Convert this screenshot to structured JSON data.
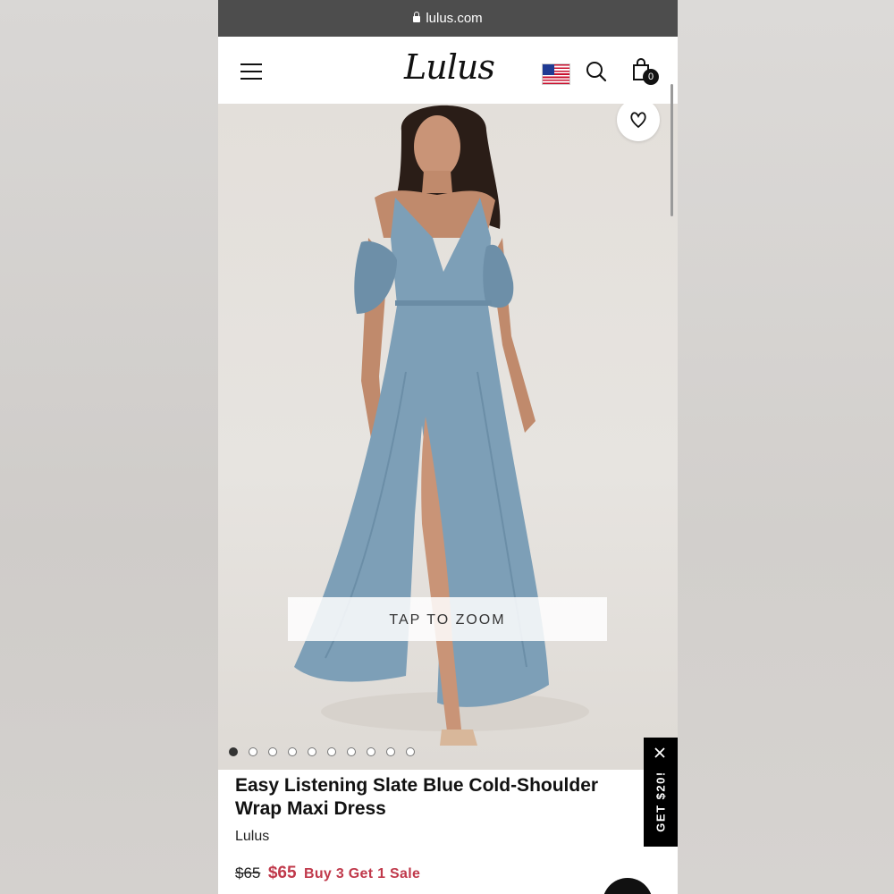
{
  "browser": {
    "url": "lulus.com"
  },
  "header": {
    "logo": "Lulus",
    "cart_count": "0"
  },
  "hero": {
    "zoom_label": "TAP TO ZOOM",
    "image_count": 10,
    "active_image": 1
  },
  "product": {
    "title": "Easy Listening Slate Blue Cold-Shoulder Wrap Maxi Dress",
    "brand": "Lulus",
    "original_price": "$65",
    "sale_price": "$65",
    "promo": "Buy 3 Get 1 Sale"
  },
  "promo_tab": {
    "label": "GET $20!"
  },
  "colors": {
    "accent": "#c0394b",
    "dress": "#7d9fb7",
    "header_bar": "#4d4d4d"
  }
}
